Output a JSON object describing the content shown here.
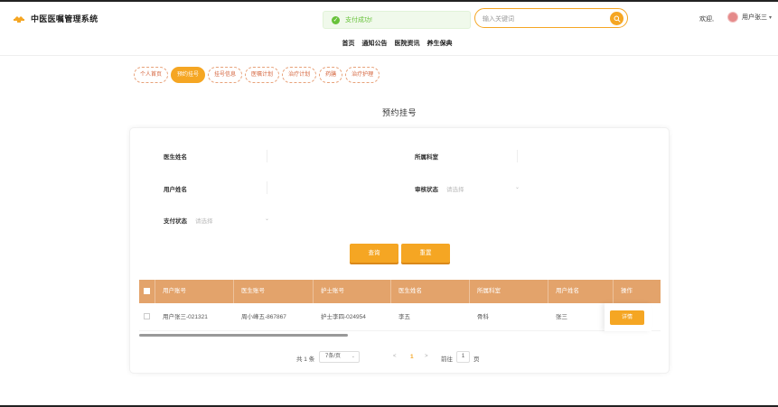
{
  "app": {
    "title": "中医医嘱管理系统"
  },
  "toast": {
    "text": "支付成功!"
  },
  "search": {
    "placeholder": "输入关键词"
  },
  "header": {
    "welcome": "欢迎,",
    "username": "用户张三"
  },
  "nav": {
    "items": [
      "首页",
      "通知公告",
      "医院资讯",
      "养生保典"
    ]
  },
  "tabs": {
    "items": [
      "个人首页",
      "预约挂号",
      "挂号信息",
      "医嘱计划",
      "治疗计划",
      "药膳",
      "治疗护理"
    ],
    "active_index": 1
  },
  "page": {
    "title": "预约挂号"
  },
  "form": {
    "doctor_name_label": "医生姓名",
    "department_label": "所属科室",
    "user_name_label": "用户姓名",
    "review_status_label": "审核状态",
    "review_status_placeholder": "请选择",
    "payment_status_label": "支付状态",
    "payment_status_placeholder": "请选择",
    "query_label": "查询",
    "reset_label": "重置"
  },
  "table": {
    "columns": [
      "用户账号",
      "医生账号",
      "护士账号",
      "医生姓名",
      "所属科室",
      "用户姓名",
      "操作"
    ],
    "rows": [
      {
        "cells": [
          "用户张三-021321",
          "周小峰五-867867",
          "护士李四-024954",
          "李五",
          "骨科",
          "张三"
        ],
        "action": "详情"
      }
    ]
  },
  "pagination": {
    "total": "共 1 条",
    "page_size": "7条/页",
    "prev": "<",
    "current_page": "1",
    "next": ">",
    "goto_prefix": "前往",
    "goto_value": "1",
    "goto_suffix": "页"
  },
  "colors": {
    "accent": "#f5a623",
    "table_header": "#e3a36b",
    "tab_border": "#e8a27a",
    "success": "#67c23a"
  },
  "icons": {
    "logo": "medical-cap-icon",
    "toast": "check-circle-icon",
    "search": "search-icon",
    "avatar": "user-avatar"
  }
}
